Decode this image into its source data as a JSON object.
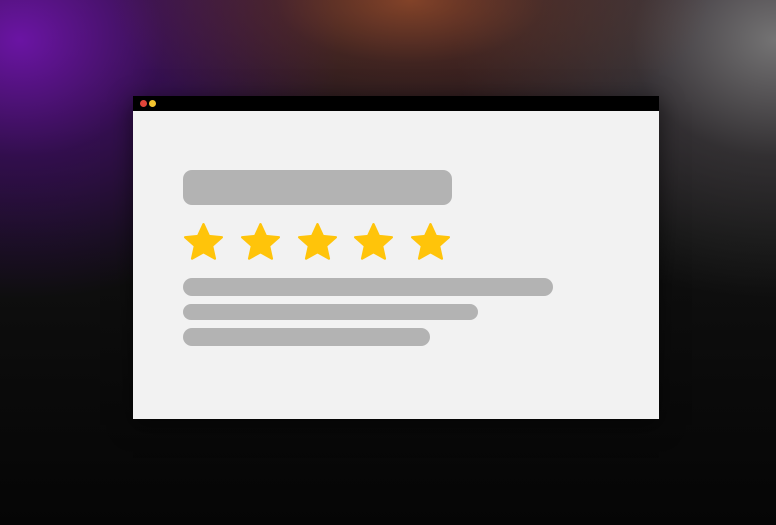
{
  "window": {
    "titlebar_color": "#000000",
    "content_background": "#f2f2f2",
    "controls": [
      {
        "name": "close",
        "color": "#e0453a"
      },
      {
        "name": "minimize",
        "color": "#f4c430"
      }
    ]
  },
  "review_card": {
    "placeholder_color": "#b3b3b3",
    "star_color": "#ffc40a",
    "rating": 5,
    "max_rating": 5,
    "star_icon": "star-icon",
    "text_lines": 3
  }
}
